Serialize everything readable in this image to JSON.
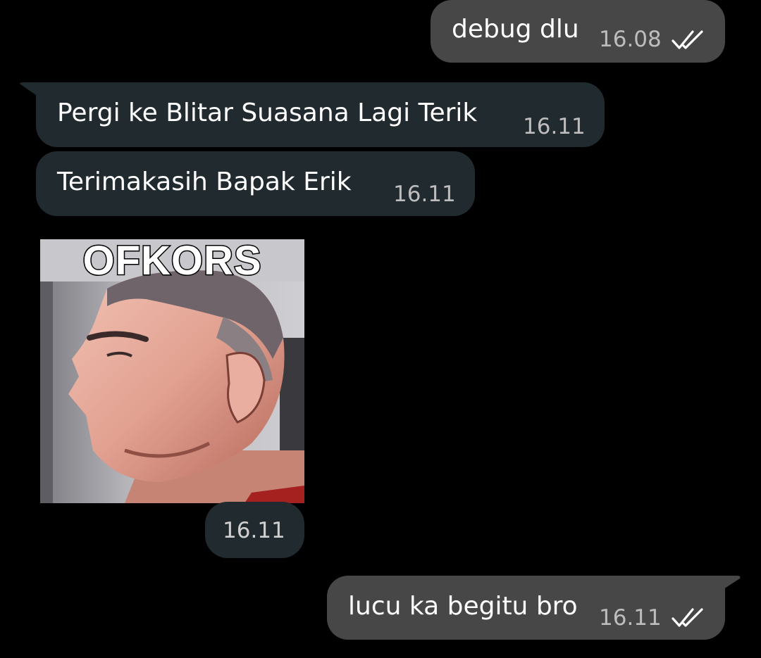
{
  "messages": [
    {
      "direction": "outgoing",
      "text": "debug dlu",
      "time": "16.08",
      "status": "read-double-check-icon"
    },
    {
      "direction": "incoming",
      "text": "Pergi ke Blitar Suasana Lagi Terik",
      "time": "16.11"
    },
    {
      "direction": "incoming",
      "text": "Terimakasih Bapak Erik",
      "time": "16.11"
    },
    {
      "direction": "incoming",
      "type": "sticker",
      "caption": "OFKORS",
      "time": "16.11"
    },
    {
      "direction": "outgoing",
      "text": "lucu ka begitu bro",
      "time": "16.11",
      "status": "read-double-check-icon"
    }
  ],
  "colors": {
    "background": "#000000",
    "outgoing_bubble": "#474747",
    "incoming_bubble": "#212a2e",
    "timestamp": "#bdbdbd"
  }
}
